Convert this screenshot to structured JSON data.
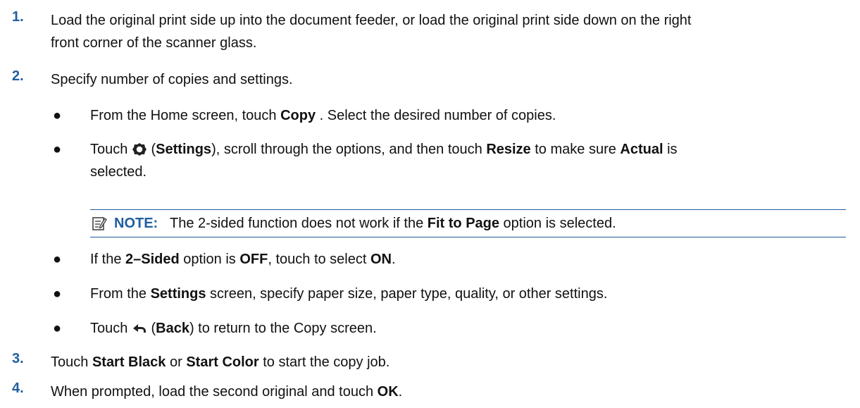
{
  "steps": [
    {
      "num": "1.",
      "line1": "Load the original print side up into the document feeder, or load the original print side down on the right",
      "line2": "front corner of the scanner glass."
    },
    {
      "num": "2.",
      "text": "Specify number of copies and settings."
    },
    {
      "num": "3.",
      "t1": "Touch ",
      "b1": "Start Black",
      "t2": " or ",
      "b2": "Start Color",
      "t3": " to start the copy job."
    },
    {
      "num": "4.",
      "t1": "When prompted, load the second original and touch ",
      "b1": "OK",
      "t2": "."
    }
  ],
  "bullets": {
    "dot": "●",
    "b1": {
      "t1": "From the Home screen, touch ",
      "b1": "Copy",
      "t2": " . Select the desired number of copies."
    },
    "b2": {
      "t1": "Touch ",
      "icon": "gear-icon",
      "t2": " (",
      "b1": "Settings",
      "t3": "), scroll through the options, and then touch ",
      "b2": "Resize",
      "t4": " to make sure ",
      "b3": "Actual",
      "t5": " is",
      "line2": "selected."
    },
    "b3": {
      "t1": "If the ",
      "b1": "2–Sided",
      "t2": " option is ",
      "b2": "OFF",
      "t3": ", touch to select ",
      "b3": "ON",
      "t4": "."
    },
    "b4": {
      "t1": "From the ",
      "b1": "Settings",
      "t2": " screen, specify paper size, paper type, quality, or other settings."
    },
    "b5": {
      "t1": "Touch ",
      "icon": "back-arrow-icon",
      "t2": " (",
      "b1": "Back",
      "t3": ") to return to the Copy screen."
    }
  },
  "note": {
    "icon": "note-icon",
    "label": "NOTE:",
    "t1": "The 2-sided function does not work if the ",
    "b1": "Fit to Page",
    "t2": " option is selected."
  },
  "colors": {
    "accent": "#1f5f9f",
    "text": "#111111"
  }
}
